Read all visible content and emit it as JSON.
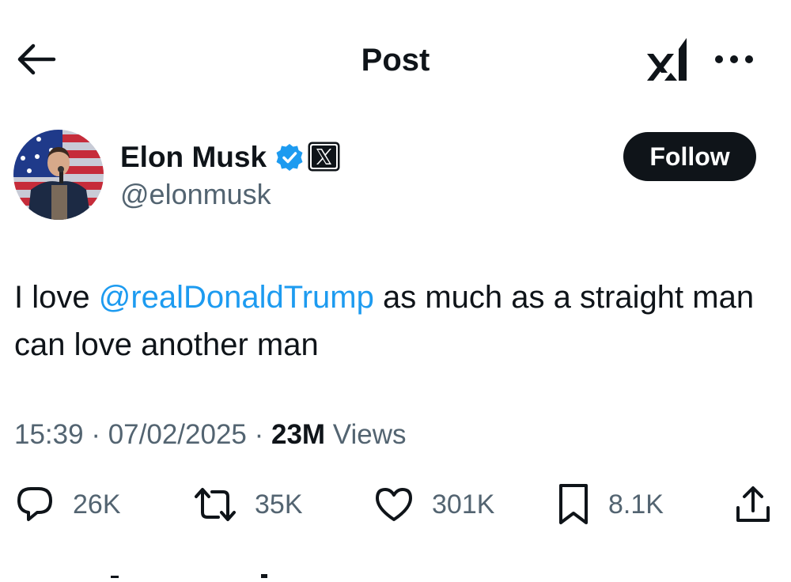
{
  "header": {
    "title": "Post",
    "back_icon": "arrow-left-icon",
    "grok_icon": "grok-logo-icon",
    "more_icon": "more-horizontal-icon"
  },
  "author": {
    "name": "Elon Musk",
    "handle": "@elonmusk",
    "verified_icon": "verified-badge-icon",
    "affiliation_icon": "x-logo-badge-icon",
    "follow_label": "Follow"
  },
  "post": {
    "text_before": "I love ",
    "mention": "@realDonaldTrump",
    "text_after": " as much as a straight man can love another man",
    "time": "15:39",
    "separator": " · ",
    "date": "07/02/2025",
    "views_count": "23M",
    "views_label": " Views"
  },
  "actions": {
    "replies": "26K",
    "reposts": "35K",
    "likes": "301K",
    "bookmarks": "8.1K"
  },
  "colors": {
    "accent": "#1d9bf0",
    "text": "#0f1419",
    "secondary": "#536471",
    "button": "#0f1419"
  }
}
